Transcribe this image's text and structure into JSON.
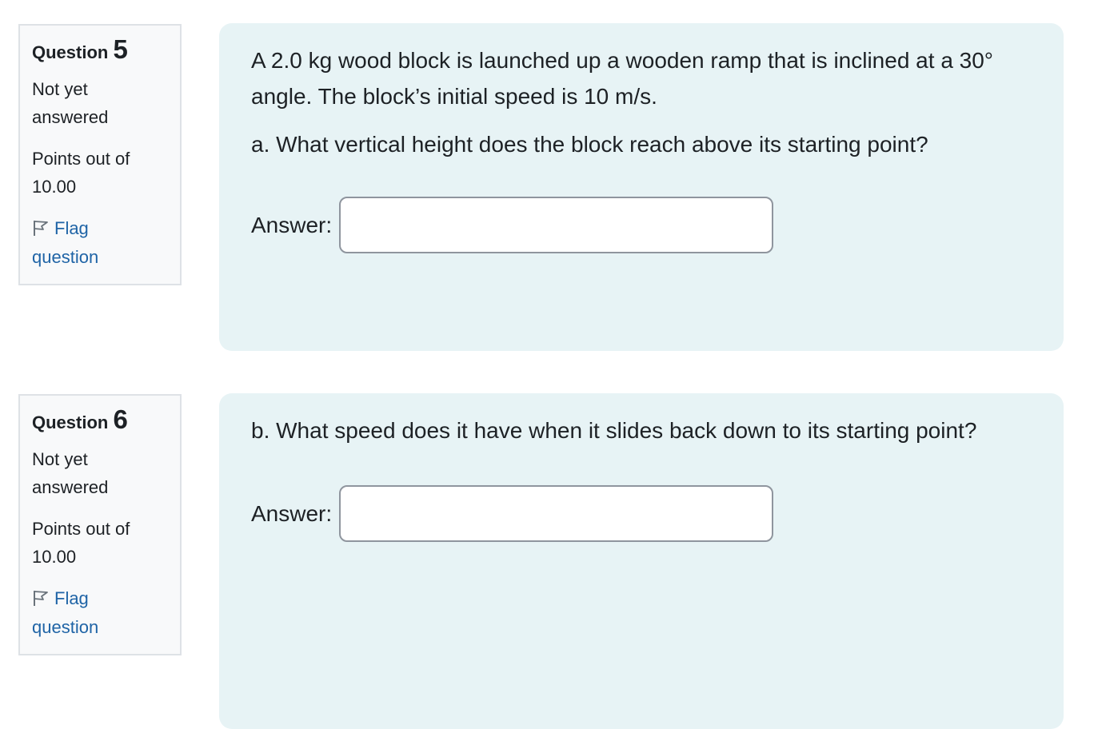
{
  "questions": [
    {
      "title_word": "Question",
      "number": "5",
      "state": "Not yet answered",
      "grade": "Points out of 10.00",
      "flag_label": "Flag question",
      "paragraphs": [
        "A 2.0 kg wood block is launched up a wooden ramp that is inclined at a 30° angle. The block’s initial speed is 10 m/s.",
        "a. What vertical height does the block reach above its starting point?"
      ],
      "answer_label": "Answer:",
      "answer_value": ""
    },
    {
      "title_word": "Question",
      "number": "6",
      "state": "Not yet answered",
      "grade": "Points out of 10.00",
      "flag_label": "Flag question",
      "paragraphs": [
        "b. What speed does it have when it slides back down to its starting point?"
      ],
      "answer_label": "Answer:",
      "answer_value": ""
    }
  ],
  "colors": {
    "info_bg": "#f8f9fa",
    "content_bg": "#e7f3f5",
    "link": "#1f64a6"
  },
  "icons": {
    "flag": "flag-outline-icon"
  }
}
